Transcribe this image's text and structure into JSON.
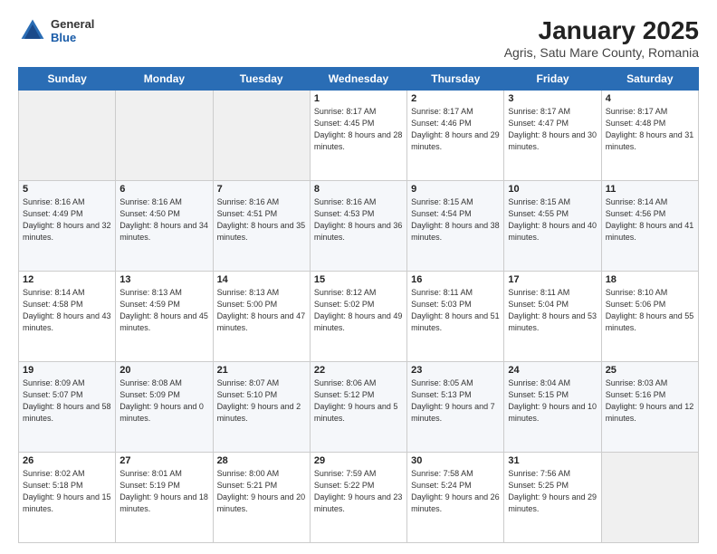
{
  "logo": {
    "general": "General",
    "blue": "Blue"
  },
  "title": "January 2025",
  "subtitle": "Agris, Satu Mare County, Romania",
  "days_of_week": [
    "Sunday",
    "Monday",
    "Tuesday",
    "Wednesday",
    "Thursday",
    "Friday",
    "Saturday"
  ],
  "weeks": [
    [
      {
        "day": "",
        "sunrise": "",
        "sunset": "",
        "daylight": ""
      },
      {
        "day": "",
        "sunrise": "",
        "sunset": "",
        "daylight": ""
      },
      {
        "day": "",
        "sunrise": "",
        "sunset": "",
        "daylight": ""
      },
      {
        "day": "1",
        "sunrise": "Sunrise: 8:17 AM",
        "sunset": "Sunset: 4:45 PM",
        "daylight": "Daylight: 8 hours and 28 minutes."
      },
      {
        "day": "2",
        "sunrise": "Sunrise: 8:17 AM",
        "sunset": "Sunset: 4:46 PM",
        "daylight": "Daylight: 8 hours and 29 minutes."
      },
      {
        "day": "3",
        "sunrise": "Sunrise: 8:17 AM",
        "sunset": "Sunset: 4:47 PM",
        "daylight": "Daylight: 8 hours and 30 minutes."
      },
      {
        "day": "4",
        "sunrise": "Sunrise: 8:17 AM",
        "sunset": "Sunset: 4:48 PM",
        "daylight": "Daylight: 8 hours and 31 minutes."
      }
    ],
    [
      {
        "day": "5",
        "sunrise": "Sunrise: 8:16 AM",
        "sunset": "Sunset: 4:49 PM",
        "daylight": "Daylight: 8 hours and 32 minutes."
      },
      {
        "day": "6",
        "sunrise": "Sunrise: 8:16 AM",
        "sunset": "Sunset: 4:50 PM",
        "daylight": "Daylight: 8 hours and 34 minutes."
      },
      {
        "day": "7",
        "sunrise": "Sunrise: 8:16 AM",
        "sunset": "Sunset: 4:51 PM",
        "daylight": "Daylight: 8 hours and 35 minutes."
      },
      {
        "day": "8",
        "sunrise": "Sunrise: 8:16 AM",
        "sunset": "Sunset: 4:53 PM",
        "daylight": "Daylight: 8 hours and 36 minutes."
      },
      {
        "day": "9",
        "sunrise": "Sunrise: 8:15 AM",
        "sunset": "Sunset: 4:54 PM",
        "daylight": "Daylight: 8 hours and 38 minutes."
      },
      {
        "day": "10",
        "sunrise": "Sunrise: 8:15 AM",
        "sunset": "Sunset: 4:55 PM",
        "daylight": "Daylight: 8 hours and 40 minutes."
      },
      {
        "day": "11",
        "sunrise": "Sunrise: 8:14 AM",
        "sunset": "Sunset: 4:56 PM",
        "daylight": "Daylight: 8 hours and 41 minutes."
      }
    ],
    [
      {
        "day": "12",
        "sunrise": "Sunrise: 8:14 AM",
        "sunset": "Sunset: 4:58 PM",
        "daylight": "Daylight: 8 hours and 43 minutes."
      },
      {
        "day": "13",
        "sunrise": "Sunrise: 8:13 AM",
        "sunset": "Sunset: 4:59 PM",
        "daylight": "Daylight: 8 hours and 45 minutes."
      },
      {
        "day": "14",
        "sunrise": "Sunrise: 8:13 AM",
        "sunset": "Sunset: 5:00 PM",
        "daylight": "Daylight: 8 hours and 47 minutes."
      },
      {
        "day": "15",
        "sunrise": "Sunrise: 8:12 AM",
        "sunset": "Sunset: 5:02 PM",
        "daylight": "Daylight: 8 hours and 49 minutes."
      },
      {
        "day": "16",
        "sunrise": "Sunrise: 8:11 AM",
        "sunset": "Sunset: 5:03 PM",
        "daylight": "Daylight: 8 hours and 51 minutes."
      },
      {
        "day": "17",
        "sunrise": "Sunrise: 8:11 AM",
        "sunset": "Sunset: 5:04 PM",
        "daylight": "Daylight: 8 hours and 53 minutes."
      },
      {
        "day": "18",
        "sunrise": "Sunrise: 8:10 AM",
        "sunset": "Sunset: 5:06 PM",
        "daylight": "Daylight: 8 hours and 55 minutes."
      }
    ],
    [
      {
        "day": "19",
        "sunrise": "Sunrise: 8:09 AM",
        "sunset": "Sunset: 5:07 PM",
        "daylight": "Daylight: 8 hours and 58 minutes."
      },
      {
        "day": "20",
        "sunrise": "Sunrise: 8:08 AM",
        "sunset": "Sunset: 5:09 PM",
        "daylight": "Daylight: 9 hours and 0 minutes."
      },
      {
        "day": "21",
        "sunrise": "Sunrise: 8:07 AM",
        "sunset": "Sunset: 5:10 PM",
        "daylight": "Daylight: 9 hours and 2 minutes."
      },
      {
        "day": "22",
        "sunrise": "Sunrise: 8:06 AM",
        "sunset": "Sunset: 5:12 PM",
        "daylight": "Daylight: 9 hours and 5 minutes."
      },
      {
        "day": "23",
        "sunrise": "Sunrise: 8:05 AM",
        "sunset": "Sunset: 5:13 PM",
        "daylight": "Daylight: 9 hours and 7 minutes."
      },
      {
        "day": "24",
        "sunrise": "Sunrise: 8:04 AM",
        "sunset": "Sunset: 5:15 PM",
        "daylight": "Daylight: 9 hours and 10 minutes."
      },
      {
        "day": "25",
        "sunrise": "Sunrise: 8:03 AM",
        "sunset": "Sunset: 5:16 PM",
        "daylight": "Daylight: 9 hours and 12 minutes."
      }
    ],
    [
      {
        "day": "26",
        "sunrise": "Sunrise: 8:02 AM",
        "sunset": "Sunset: 5:18 PM",
        "daylight": "Daylight: 9 hours and 15 minutes."
      },
      {
        "day": "27",
        "sunrise": "Sunrise: 8:01 AM",
        "sunset": "Sunset: 5:19 PM",
        "daylight": "Daylight: 9 hours and 18 minutes."
      },
      {
        "day": "28",
        "sunrise": "Sunrise: 8:00 AM",
        "sunset": "Sunset: 5:21 PM",
        "daylight": "Daylight: 9 hours and 20 minutes."
      },
      {
        "day": "29",
        "sunrise": "Sunrise: 7:59 AM",
        "sunset": "Sunset: 5:22 PM",
        "daylight": "Daylight: 9 hours and 23 minutes."
      },
      {
        "day": "30",
        "sunrise": "Sunrise: 7:58 AM",
        "sunset": "Sunset: 5:24 PM",
        "daylight": "Daylight: 9 hours and 26 minutes."
      },
      {
        "day": "31",
        "sunrise": "Sunrise: 7:56 AM",
        "sunset": "Sunset: 5:25 PM",
        "daylight": "Daylight: 9 hours and 29 minutes."
      },
      {
        "day": "",
        "sunrise": "",
        "sunset": "",
        "daylight": ""
      }
    ]
  ]
}
